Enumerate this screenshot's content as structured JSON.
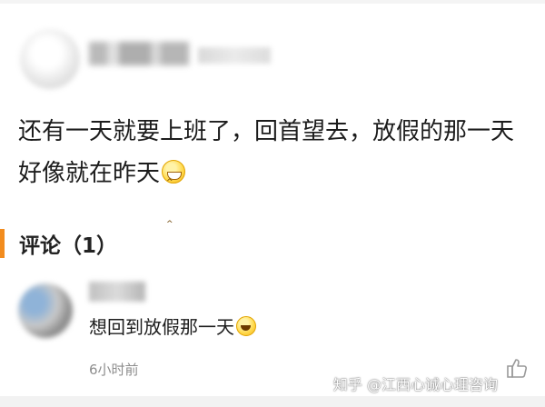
{
  "post": {
    "text": "还有一天就要上班了，回首望去，放假的那一天好像就在昨天"
  },
  "comments_section": {
    "title": "评论（1）"
  },
  "comment": {
    "text": "想回到放假那一天",
    "time": "6小时前"
  },
  "watermark": {
    "text": "知乎 @江西心诚心理咨询"
  },
  "colors": {
    "accent": "#f28c1e",
    "time_text": "#8d8d8d"
  },
  "icons": {
    "post_emoji": "grinning-face-icon",
    "comment_emoji": "tears-of-joy-icon",
    "like": "thumbs-up-icon"
  }
}
